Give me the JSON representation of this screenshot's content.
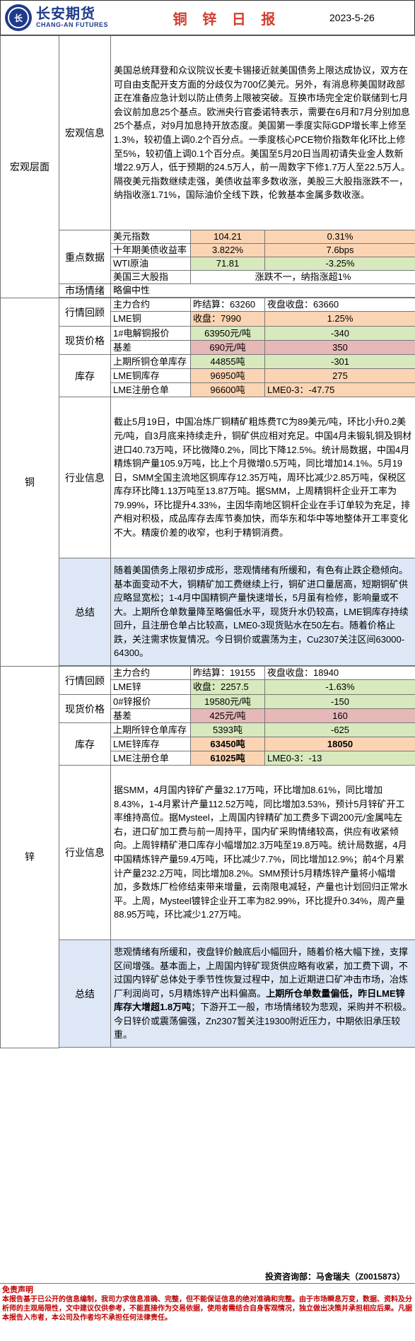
{
  "header": {
    "logo_cn": "长安期货",
    "logo_en": "CHANG-AN FUTURES",
    "title": "铜 锌 日 报",
    "date": "2023-5-26"
  },
  "macro": {
    "section": "宏观层面",
    "info_label": "宏观信息",
    "info_text": "美国总统拜登和众议院议长麦卡锡接近就美国债务上限达成协议，双方在可自由支配开支方面的分歧仅为700亿美元。另外，有消息称美国财政部正在准备应急计划以防止债务上限被突破。互换市场完全定价联储到七月会议前加息25个基点。欧洲央行官委诺特表示，需要在6月和7月分别加息25个基点，对9月加息持开放态度。美国第一季度实际GDP增长率上修至1.3%，较初值上调0.2个百分点。一季度核心PCE物价指数年化环比上修至5%，较初值上调0.1个百分点。美国至5月20日当周初请失业金人数新增22.9万人，低于预期的24.5万人，前一周数字下修1.7万人至22.5万人。隔夜美元指数继续走强，美债收益率多数收涨，美股三大股指涨跌不一，纳指收涨1.71%，国际油价全线下跌，伦敦基本金属多数收涨。",
    "key_label": "重点数据",
    "key_rows": [
      {
        "name": "美元指数",
        "v1": "104.21",
        "v2": "0.31%"
      },
      {
        "name": "十年期美债收益率",
        "v1": "3.822%",
        "v2": "7.6bps"
      },
      {
        "name": "WTI原油",
        "v1": "71.81",
        "v2": "-3.25%"
      },
      {
        "name": "美国三大股指",
        "merged": "涨跌不一，纳指涨超1%"
      }
    ],
    "sentiment_label": "市场情绪",
    "sentiment_value": "略偏中性"
  },
  "copper": {
    "section": "铜",
    "review_label": "行情回顾",
    "review_rows": [
      {
        "a": "主力合约",
        "b": "昨结算：63260",
        "c": "夜盘收盘：63660"
      },
      {
        "a": "LME铜",
        "b": "收盘：7990",
        "c": "1.25%"
      }
    ],
    "spot_label": "现货价格",
    "spot_rows": [
      {
        "a": "1#电解铜报价",
        "b": "63950元/吨",
        "c": "-340"
      },
      {
        "a": "基差",
        "b": "690元/吨",
        "c": "350"
      }
    ],
    "stock_label": "库存",
    "stock_rows": [
      {
        "a": "上期所铜仓单库存",
        "b": "44855吨",
        "c": "-301"
      },
      {
        "a": "LME铜库存",
        "b": "96950吨",
        "c": "275"
      },
      {
        "a": "LME注册仓单",
        "b": "96600吨",
        "c": "LME0-3：-47.75"
      }
    ],
    "industry_label": "行业信息",
    "industry_text": "截止5月19日，中国冶炼厂铜精矿粗炼费TC为89美元/吨，环比小升0.2美元/吨，自3月底来持续走升，铜矿供应相对充足。中国4月未锻轧铜及铜材进口40.73万吨，环比微降0.2%，同比下降12.5%。统计局数据，中国4月精炼铜产量105.9万吨，比上个月微增0.5万吨，同比增加14.1%。5月19日，SMM全国主流地区铜库存12.35万吨，周环比减少2.85万吨，保税区库存环比降1.13万吨至13.87万吨。据SMM，上周精铜杆企业开工率为79.99%，环比提升4.33%，主因华南地区铜杆企业在手订单较为充足，排产相对积极，成品库存去库节奏加快，而华东和华中等地整体开工率变化不大。精废价差的收窄，也利于精铜消费。",
    "summary_label": "总结",
    "summary_text": "随着美国债务上限初步成形，悲观情绪有所缓和，有色有止跌企稳倾向。基本面变动不大，铜精矿加工费继续上行，铜矿进口量居高，短期铜矿供应略显宽松；1-4月中国精铜产量快速增长，5月虽有检修，影响量或不大。上期所仓单数量降至略偏低水平，现货升水仍较高，LME铜库存持续回升，且注册仓单占比较高，LME0-3现货贴水在50左右。随着价格止跌，关注需求恢复情况。今日铜价或震荡为主，Cu2307关注区间63000-64300。"
  },
  "zinc": {
    "section": "锌",
    "review_label": "行情回顾",
    "review_rows": [
      {
        "a": "主力合约",
        "b": "昨结算：19155",
        "c": "夜盘收盘：18940"
      },
      {
        "a": "LME锌",
        "b": "收盘：2257.5",
        "c": "-1.63%"
      }
    ],
    "spot_label": "现货价格",
    "spot_rows": [
      {
        "a": "0#锌报价",
        "b": "19580元/吨",
        "c": "-150"
      },
      {
        "a": "基差",
        "b": "425元/吨",
        "c": "160"
      }
    ],
    "stock_label": "库存",
    "stock_rows": [
      {
        "a": "上期所锌仓单库存",
        "b": "5393吨",
        "c": "-625"
      },
      {
        "a": "LME锌库存",
        "b": "63450吨",
        "c": "18050"
      },
      {
        "a": "LME注册仓单",
        "b": "61025吨",
        "c": "LME0-3：-13"
      }
    ],
    "industry_label": "行业信息",
    "industry_text": "据SMM，4月国内锌矿产量32.17万吨，环比增加8.61%，同比增加8.43%，1-4月累计产量112.52万吨，同比增加3.53%，预计5月锌矿开工率维持高位。据Mysteel，上周国内锌精矿加工费多下调200元/金属吨左右，进口矿加工费与前一周持平，国内矿采购情绪较高，供应有收紧倾向。上周锌精矿港口库存小幅增加2.3万吨至19.8万吨。统计局数据，4月中国精炼锌产量59.4万吨，环比减少7.7%，同比增加12.9%；前4个月累计产量232.2万吨，同比增加8.2%。SMM预计5月精炼锌产量将小幅增加，多数炼厂检修结束带来增量，云南限电减轻，产量也计划回归正常水平。上周，Mysteel镀锌企业开工率为82.99%，环比提升0.34%，周产量88.95万吨，环比减少1.27万吨。",
    "summary_label": "总结",
    "summary_pre": "悲观情绪有所缓和，夜盘锌价触底后小幅回升，随着价格大幅下挫，支撑区间增强。基本面上，上周国内锌矿现货供应略有收紧，加工费下调，不过国内锌矿总体处于季节性恢复过程中，加上近期进口矿冲击市场，冶炼厂利润尚可，5月精炼锌产出料偏高。",
    "summary_bold": "上期所仓单数量偏低，昨日LME锌库存大增超1.8万吨",
    "summary_post": "；下游开工一般，市场情绪较为悲观，采购并不积极。今日锌价或震荡偏强，Zn2307暂关注19300附近压力，中期依旧承压较重。"
  },
  "footer": {
    "consultant": "投资咨询部：马舍瑞夫（Z0015873）",
    "disclaimer_title": "免责声明",
    "disclaimer_body": "本报告基于已公开的信息编制，我司力求信息准确、完整，但不能保证信息的绝对准确和完整。由于市场瞬息万变，数据、资料及分析师的主观局限性，文中建议仅供参考，不能直接作为交易依据，使用者需结合自身客观情况，独立做出决策并承担相应后果。凡据本报告入市者，本公司及作者均不承担任何法律责任。"
  }
}
